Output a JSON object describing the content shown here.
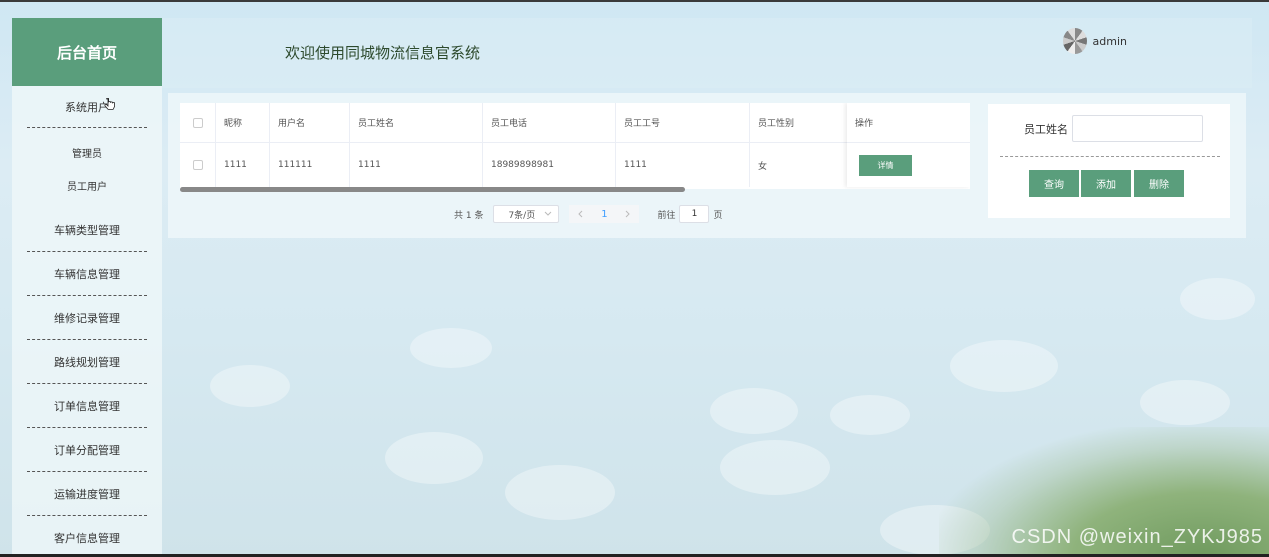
{
  "sidebar": {
    "brand": "后台首页",
    "items": [
      {
        "label": "系统用户"
      },
      {
        "label": "车辆类型管理"
      },
      {
        "label": "车辆信息管理"
      },
      {
        "label": "维修记录管理"
      },
      {
        "label": "路线规划管理"
      },
      {
        "label": "订单信息管理"
      },
      {
        "label": "订单分配管理"
      },
      {
        "label": "运输进度管理"
      },
      {
        "label": "客户信息管理"
      }
    ],
    "sub_items": [
      {
        "label": "管理员"
      },
      {
        "label": "员工用户"
      }
    ]
  },
  "header": {
    "welcome": "欢迎使用同城物流信息官系统",
    "username": "admin"
  },
  "table": {
    "columns": [
      "昵称",
      "用户名",
      "员工姓名",
      "员工电话",
      "员工工号",
      "员工性别",
      "操作"
    ],
    "rows": [
      {
        "nickname": "1111",
        "username": "111111",
        "name": "1111",
        "phone": "18989898981",
        "employee_no": "1111",
        "gender": "女",
        "action": "详情"
      }
    ]
  },
  "pagination": {
    "total": "共 1 条",
    "page_size": "7条/页",
    "current_page": "1",
    "goto_prefix": "前往",
    "goto_value": "1",
    "goto_suffix": "页"
  },
  "search": {
    "label": "员工姓名",
    "value": "",
    "query_button": "查询",
    "add_button": "添加",
    "delete_button": "删除"
  },
  "watermark": "CSDN @weixin_ZYKJ985",
  "colors": {
    "accent": "#5a9e7c",
    "pager_active": "#409eff"
  }
}
